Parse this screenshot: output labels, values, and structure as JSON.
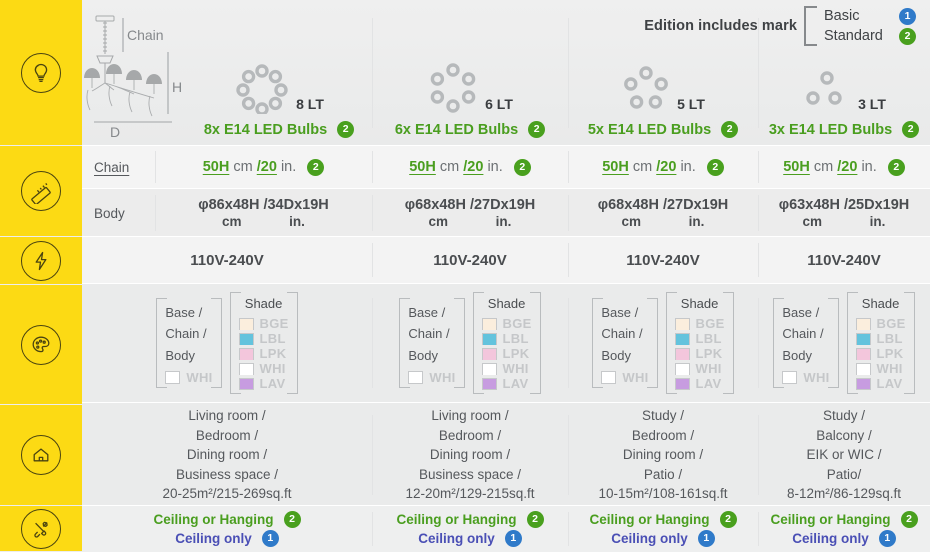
{
  "header": {
    "edition_note": "Edition includes mark",
    "options": [
      {
        "label": "Basic",
        "badge": "1"
      },
      {
        "label": "Standard",
        "badge": "2"
      }
    ]
  },
  "diagram": {
    "chain_label": "Chain",
    "height_label": "H",
    "diameter_label": "D"
  },
  "sidebar": [
    {
      "name": "bulb-icon",
      "title": "Bulbs"
    },
    {
      "name": "ruler-icon",
      "title": "Dimensions"
    },
    {
      "name": "bolt-icon",
      "title": "Voltage"
    },
    {
      "name": "palette-icon",
      "title": "Colors"
    },
    {
      "name": "house-icon",
      "title": "Rooms"
    },
    {
      "name": "tools-icon",
      "title": "Installation"
    }
  ],
  "sublabels": {
    "chain": "Chain",
    "body": "Body"
  },
  "columns": [
    {
      "lt": "8 LT",
      "bulbs": "8x E14 LED Bulbs",
      "bulbs_badge": "2",
      "bulb_count": 8,
      "chain": {
        "h": "50H",
        "unit_cm": "cm",
        "slash_in": "/20",
        "unit_in": "in.",
        "badge": "2"
      },
      "body_metric": "φ86x48H",
      "body_imperial": "/34Dx19H",
      "body_unit_cm": "cm",
      "body_unit_in": "in.",
      "voltage": "110V-240V",
      "rooms": "Living room /\nBedroom /\nDining room /\nBusiness space /\n20-25m²/215-269sq.ft",
      "install_primary": "Ceiling or Hanging",
      "install_primary_badge": "2",
      "install_secondary": "Ceiling only",
      "install_secondary_badge": "1"
    },
    {
      "lt": "6 LT",
      "bulbs": "6x E14 LED Bulbs",
      "bulbs_badge": "2",
      "bulb_count": 6,
      "chain": {
        "h": "50H",
        "unit_cm": "cm",
        "slash_in": "/20",
        "unit_in": "in.",
        "badge": "2"
      },
      "body_metric": "φ68x48H",
      "body_imperial": "/27Dx19H",
      "body_unit_cm": "cm",
      "body_unit_in": "in.",
      "voltage": "110V-240V",
      "rooms": "Living room /\nBedroom /\nDining room /\nBusiness space /\n12-20m²/129-215sq.ft",
      "install_primary": "Ceiling or Hanging",
      "install_primary_badge": "2",
      "install_secondary": "Ceiling only",
      "install_secondary_badge": "1"
    },
    {
      "lt": "5 LT",
      "bulbs": "5x E14 LED Bulbs",
      "bulbs_badge": "2",
      "bulb_count": 5,
      "chain": {
        "h": "50H",
        "unit_cm": "cm",
        "slash_in": "/20",
        "unit_in": "in.",
        "badge": "2"
      },
      "body_metric": "φ68x48H",
      "body_imperial": "/27Dx19H",
      "body_unit_cm": "cm",
      "body_unit_in": "in.",
      "voltage": "110V-240V",
      "rooms": "Study /\nBedroom /\nDining room /\nPatio /\n10-15m²/108-161sq.ft",
      "install_primary": "Ceiling or Hanging",
      "install_primary_badge": "2",
      "install_secondary": "Ceiling only",
      "install_secondary_badge": "1"
    },
    {
      "lt": "3 LT",
      "bulbs": "3x E14 LED Bulbs",
      "bulbs_badge": "2",
      "bulb_count": 3,
      "chain": {
        "h": "50H",
        "unit_cm": "cm",
        "slash_in": "/20",
        "unit_in": "in.",
        "badge": "2"
      },
      "body_metric": "φ63x48H",
      "body_imperial": "/25Dx19H",
      "body_unit_cm": "cm",
      "body_unit_in": "in.",
      "voltage": "110V-240V",
      "rooms": "Study /\nBalcony /\nEIK or WIC /\nPatio/\n8-12m²/86-129sq.ft",
      "install_primary": "Ceiling or Hanging",
      "install_primary_badge": "2",
      "install_secondary": "Ceiling only",
      "install_secondary_badge": "1"
    }
  ],
  "colors": {
    "base_title": "Base /",
    "base_lines": [
      "Base /",
      "Chain /",
      "Body"
    ],
    "base_swatch_label": "WHI",
    "base_swatch_color": "#ffffff",
    "shade_title": "Shade",
    "shades": [
      {
        "label": "BGE",
        "color": "#fbeedd"
      },
      {
        "label": "LBL",
        "color": "#63c3dd"
      },
      {
        "label": "LPK",
        "color": "#f3c6dc"
      },
      {
        "label": "WHI",
        "color": "#ffffff"
      },
      {
        "label": "LAV",
        "color": "#c79ce0"
      }
    ]
  },
  "theme": {
    "sidebar_yellow": "#FCDA14",
    "green": "#4a9e1f",
    "blue": "#2f7ac9",
    "indigo": "#4a4fb5"
  }
}
